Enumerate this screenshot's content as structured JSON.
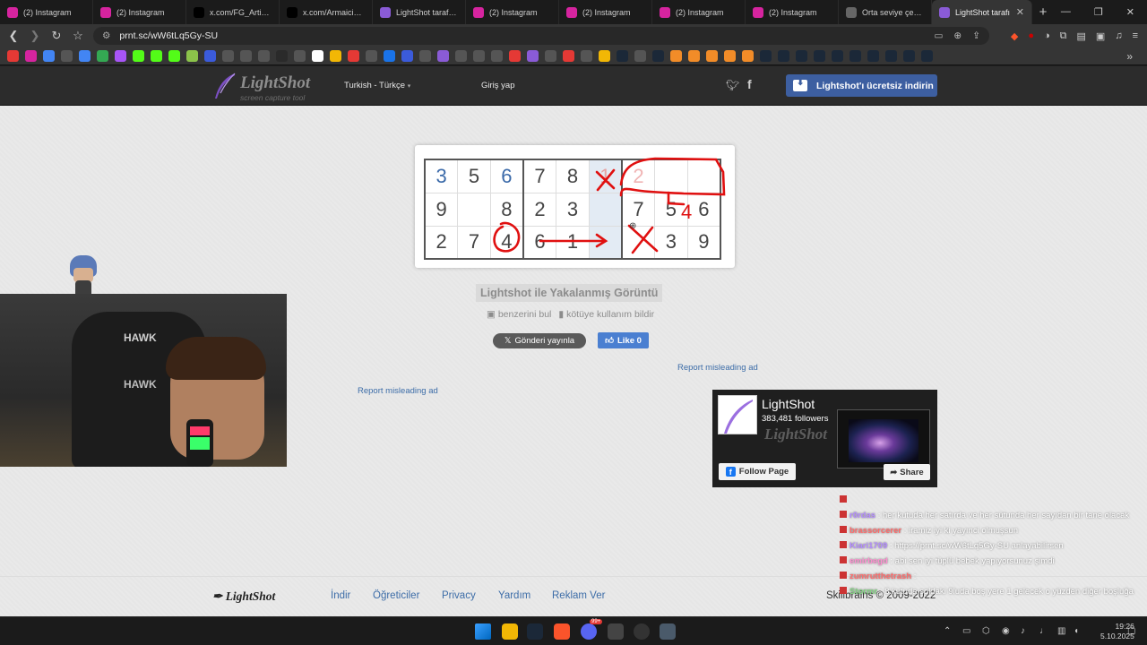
{
  "tabs": [
    {
      "label": "(2) Instagram",
      "icon": "instagram-icon",
      "color": "#d6249f"
    },
    {
      "label": "(2) Instagram",
      "icon": "instagram-icon",
      "color": "#d6249f"
    },
    {
      "label": "x.com/FG_Artist/sta",
      "icon": "x-icon",
      "color": "#000000"
    },
    {
      "label": "x.com/Armaicinkav",
      "icon": "x-icon",
      "color": "#000000"
    },
    {
      "label": "LightShot tarafından",
      "icon": "lightshot-feather-icon",
      "color": "#8a5bd6"
    },
    {
      "label": "(2) Instagram",
      "icon": "instagram-icon",
      "color": "#d6249f"
    },
    {
      "label": "(2) Instagram",
      "icon": "instagram-icon",
      "color": "#d6249f"
    },
    {
      "label": "(2) Instagram",
      "icon": "instagram-icon",
      "color": "#d6249f"
    },
    {
      "label": "(2) Instagram",
      "icon": "instagram-icon",
      "color": "#d6249f"
    },
    {
      "label": "Orta seviye çevrimiç",
      "icon": "grid-icon",
      "color": "#666666"
    },
    {
      "label": "LightShot tarafı",
      "icon": "lightshot-feather-icon",
      "color": "#8a5bd6",
      "active": true
    }
  ],
  "address": {
    "url": "prnt.sc/wW6tLq5Gy-SU"
  },
  "bookmark_colors": [
    "#e53935",
    "#d6249f",
    "#4285f4",
    "#555",
    "#4285f4",
    "#34a853",
    "#a855f7",
    "#53fc18",
    "#53fc18",
    "#53fc18",
    "#8bc34a",
    "#3b5bdb",
    "#555",
    "#555",
    "#555",
    "#2a2a2a",
    "#555",
    "#fff",
    "#f2b705",
    "#e53935",
    "#555",
    "#1a73e8",
    "#3b5bdb",
    "#555",
    "#8a5bd6",
    "#555",
    "#555",
    "#555",
    "#e53935",
    "#8a5bd6",
    "#555",
    "#e53935",
    "#555",
    "#f2b705",
    "#1b2838",
    "#555",
    "#1b2838",
    "#f28c28",
    "#f28c28",
    "#f28c28",
    "#f28c28",
    "#f28c28",
    "#1b2838",
    "#1b2838",
    "#1b2838",
    "#1b2838",
    "#1b2838",
    "#1b2838",
    "#1b2838",
    "#1b2838",
    "#1b2838",
    "#1b2838"
  ],
  "header": {
    "logo_title": "LightShot",
    "logo_sub": "screen capture tool",
    "language": "Turkish - Türkçe",
    "login": "Giriş yap",
    "download": "Lightshot'ı ücretsiz indirin",
    "brand_color": "#3d5fa1"
  },
  "screenshot": {
    "rows": [
      [
        "3",
        "5",
        "6",
        "7",
        "8",
        "1",
        "2",
        "",
        ""
      ],
      [
        "9",
        "",
        "8",
        "2",
        "3",
        "",
        "7",
        "5",
        "6"
      ],
      [
        "2",
        "7",
        "4",
        "6",
        "1",
        "",
        "",
        "3",
        "9"
      ]
    ],
    "annotation_labels": [
      "4"
    ]
  },
  "caption": {
    "title": "Lightshot ile Yakalanmış Görüntü",
    "find_similar": "benzerini bul",
    "report_abuse": "kötüye kullanım bildir"
  },
  "social": {
    "tweet": "Gönderi yayınla",
    "like": "Like 0"
  },
  "ads": {
    "report1": "Report misleading ad",
    "report2": "Report misleading ad"
  },
  "fb_widget": {
    "name": "LightShot",
    "followers": "383,481 followers",
    "watermark": "LightShot",
    "follow": "Follow Page",
    "share": "Share"
  },
  "footer": {
    "logo": "LightShot",
    "links": [
      "İndir",
      "Öğreticiler",
      "Privacy",
      "Yardım",
      "Reklam Ver"
    ],
    "copyright": "Skillbrains © 2009-2022"
  },
  "webcam": {
    "chair_brand": "HAWK",
    "chair_brand2": "HAWK"
  },
  "chat": [
    {
      "user": "",
      "text": "",
      "user_color": "#f2b705"
    },
    {
      "user": "r0rdas",
      "text": ": her kutuda her satırda ve her sütunda her sayıdan bir tane olacak",
      "user_color": "#b48cff"
    },
    {
      "user": "brassorcerer",
      "text": ": iramiz iyi ki yayınci olmuşsun",
      "user_color": "#ff6b6b"
    },
    {
      "user": "Kiari1709",
      "text": ": https://prnt.sc/wW6tLq5Gy-SU anlayabilirsen",
      "user_color": "#b48cff"
    },
    {
      "user": "emirbegd",
      "text": ": abi sen iyi tüplü bebek yapıyorsunuz şimdi",
      "user_color": "#ff8fd0"
    },
    {
      "user": "zumrutthetrash",
      "text": ":",
      "user_color": "#ff6b6b"
    },
    {
      "user": "Stormr",
      "text": ": 8.kutuda soldaki 9luda boş yere 1 gelecek o yüzden diğer boşluğa 4 kalıyo",
      "user_color": "#7fd17f"
    }
  ],
  "taskbar": {
    "time": "19:26",
    "date": "5.10.2025",
    "badge": "99+"
  }
}
